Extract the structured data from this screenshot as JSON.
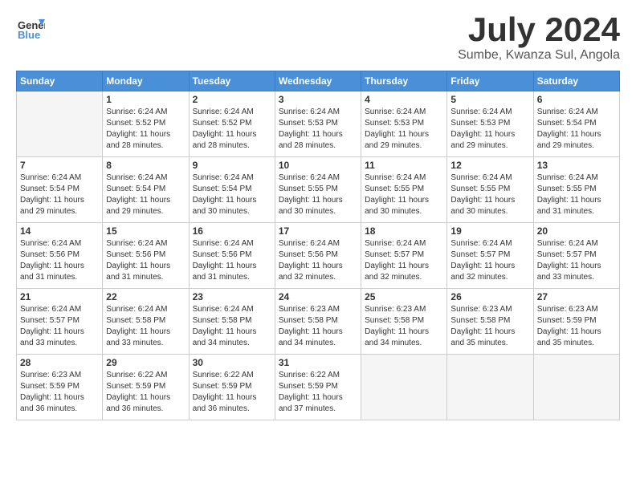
{
  "logo": {
    "line1": "General",
    "line2": "Blue"
  },
  "title": "July 2024",
  "subtitle": "Sumbe, Kwanza Sul, Angola",
  "days_of_week": [
    "Sunday",
    "Monday",
    "Tuesday",
    "Wednesday",
    "Thursday",
    "Friday",
    "Saturday"
  ],
  "weeks": [
    [
      {
        "day": "",
        "info": ""
      },
      {
        "day": "1",
        "info": "Sunrise: 6:24 AM\nSunset: 5:52 PM\nDaylight: 11 hours\nand 28 minutes."
      },
      {
        "day": "2",
        "info": "Sunrise: 6:24 AM\nSunset: 5:52 PM\nDaylight: 11 hours\nand 28 minutes."
      },
      {
        "day": "3",
        "info": "Sunrise: 6:24 AM\nSunset: 5:53 PM\nDaylight: 11 hours\nand 28 minutes."
      },
      {
        "day": "4",
        "info": "Sunrise: 6:24 AM\nSunset: 5:53 PM\nDaylight: 11 hours\nand 29 minutes."
      },
      {
        "day": "5",
        "info": "Sunrise: 6:24 AM\nSunset: 5:53 PM\nDaylight: 11 hours\nand 29 minutes."
      },
      {
        "day": "6",
        "info": "Sunrise: 6:24 AM\nSunset: 5:54 PM\nDaylight: 11 hours\nand 29 minutes."
      }
    ],
    [
      {
        "day": "7",
        "info": "Sunrise: 6:24 AM\nSunset: 5:54 PM\nDaylight: 11 hours\nand 29 minutes."
      },
      {
        "day": "8",
        "info": "Sunrise: 6:24 AM\nSunset: 5:54 PM\nDaylight: 11 hours\nand 29 minutes."
      },
      {
        "day": "9",
        "info": "Sunrise: 6:24 AM\nSunset: 5:54 PM\nDaylight: 11 hours\nand 30 minutes."
      },
      {
        "day": "10",
        "info": "Sunrise: 6:24 AM\nSunset: 5:55 PM\nDaylight: 11 hours\nand 30 minutes."
      },
      {
        "day": "11",
        "info": "Sunrise: 6:24 AM\nSunset: 5:55 PM\nDaylight: 11 hours\nand 30 minutes."
      },
      {
        "day": "12",
        "info": "Sunrise: 6:24 AM\nSunset: 5:55 PM\nDaylight: 11 hours\nand 30 minutes."
      },
      {
        "day": "13",
        "info": "Sunrise: 6:24 AM\nSunset: 5:55 PM\nDaylight: 11 hours\nand 31 minutes."
      }
    ],
    [
      {
        "day": "14",
        "info": "Sunrise: 6:24 AM\nSunset: 5:56 PM\nDaylight: 11 hours\nand 31 minutes."
      },
      {
        "day": "15",
        "info": "Sunrise: 6:24 AM\nSunset: 5:56 PM\nDaylight: 11 hours\nand 31 minutes."
      },
      {
        "day": "16",
        "info": "Sunrise: 6:24 AM\nSunset: 5:56 PM\nDaylight: 11 hours\nand 31 minutes."
      },
      {
        "day": "17",
        "info": "Sunrise: 6:24 AM\nSunset: 5:56 PM\nDaylight: 11 hours\nand 32 minutes."
      },
      {
        "day": "18",
        "info": "Sunrise: 6:24 AM\nSunset: 5:57 PM\nDaylight: 11 hours\nand 32 minutes."
      },
      {
        "day": "19",
        "info": "Sunrise: 6:24 AM\nSunset: 5:57 PM\nDaylight: 11 hours\nand 32 minutes."
      },
      {
        "day": "20",
        "info": "Sunrise: 6:24 AM\nSunset: 5:57 PM\nDaylight: 11 hours\nand 33 minutes."
      }
    ],
    [
      {
        "day": "21",
        "info": "Sunrise: 6:24 AM\nSunset: 5:57 PM\nDaylight: 11 hours\nand 33 minutes."
      },
      {
        "day": "22",
        "info": "Sunrise: 6:24 AM\nSunset: 5:58 PM\nDaylight: 11 hours\nand 33 minutes."
      },
      {
        "day": "23",
        "info": "Sunrise: 6:24 AM\nSunset: 5:58 PM\nDaylight: 11 hours\nand 34 minutes."
      },
      {
        "day": "24",
        "info": "Sunrise: 6:23 AM\nSunset: 5:58 PM\nDaylight: 11 hours\nand 34 minutes."
      },
      {
        "day": "25",
        "info": "Sunrise: 6:23 AM\nSunset: 5:58 PM\nDaylight: 11 hours\nand 34 minutes."
      },
      {
        "day": "26",
        "info": "Sunrise: 6:23 AM\nSunset: 5:58 PM\nDaylight: 11 hours\nand 35 minutes."
      },
      {
        "day": "27",
        "info": "Sunrise: 6:23 AM\nSunset: 5:59 PM\nDaylight: 11 hours\nand 35 minutes."
      }
    ],
    [
      {
        "day": "28",
        "info": "Sunrise: 6:23 AM\nSunset: 5:59 PM\nDaylight: 11 hours\nand 36 minutes."
      },
      {
        "day": "29",
        "info": "Sunrise: 6:22 AM\nSunset: 5:59 PM\nDaylight: 11 hours\nand 36 minutes."
      },
      {
        "day": "30",
        "info": "Sunrise: 6:22 AM\nSunset: 5:59 PM\nDaylight: 11 hours\nand 36 minutes."
      },
      {
        "day": "31",
        "info": "Sunrise: 6:22 AM\nSunset: 5:59 PM\nDaylight: 11 hours\nand 37 minutes."
      },
      {
        "day": "",
        "info": ""
      },
      {
        "day": "",
        "info": ""
      },
      {
        "day": "",
        "info": ""
      }
    ]
  ]
}
